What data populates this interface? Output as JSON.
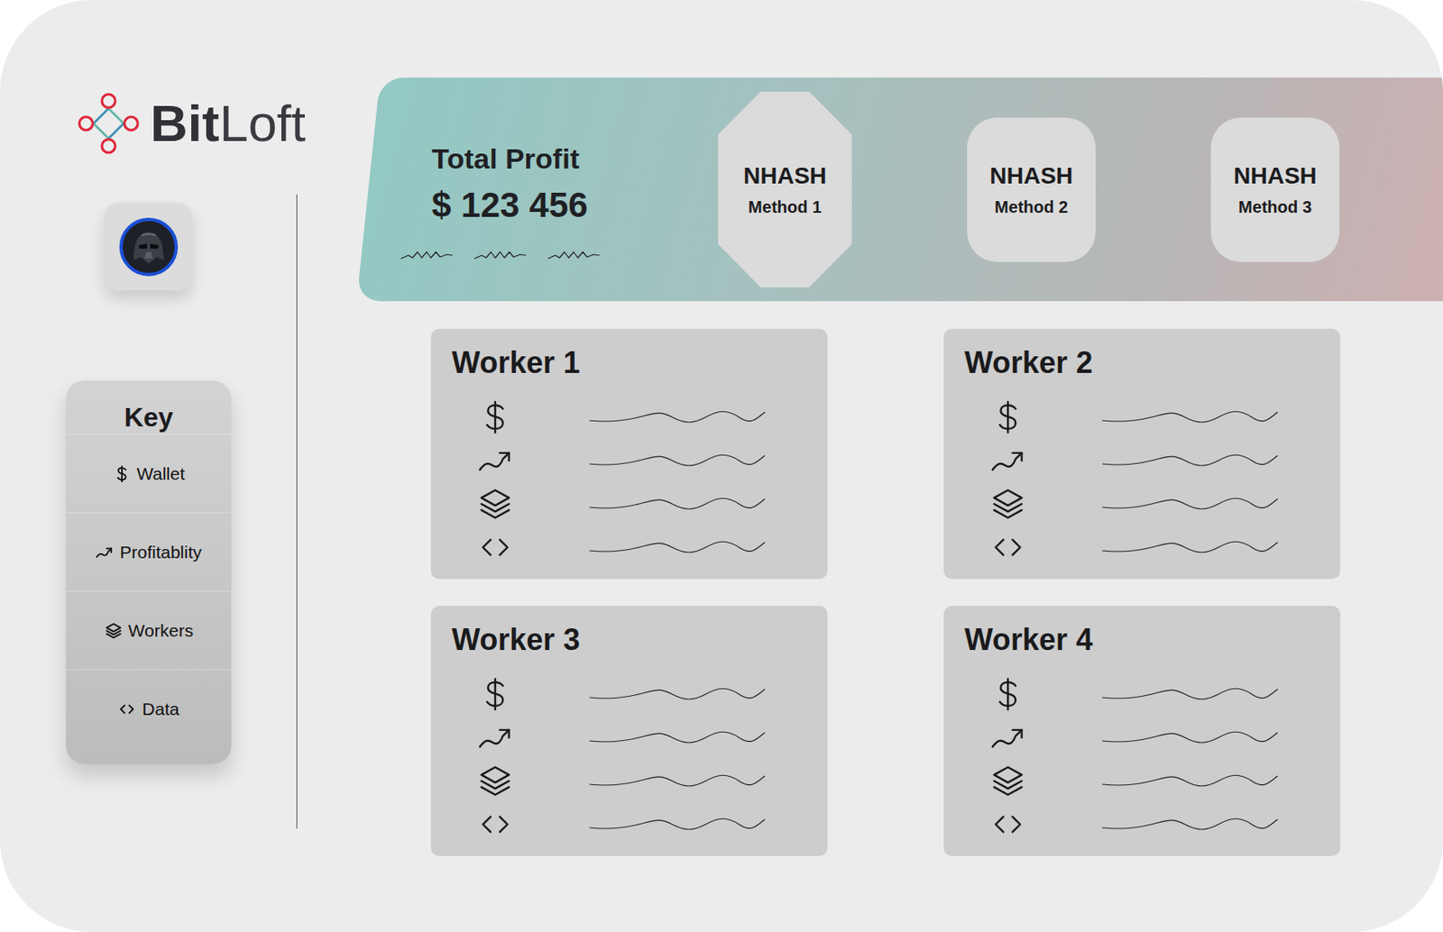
{
  "logo": {
    "bold": "Bit",
    "light": "Loft"
  },
  "key": {
    "title": "Key",
    "items": [
      {
        "kind": "wallet",
        "label": "Wallet"
      },
      {
        "kind": "profitability",
        "label": "Profitablity"
      },
      {
        "kind": "workers",
        "label": "Workers"
      },
      {
        "kind": "data",
        "label": "Data"
      }
    ]
  },
  "summary": {
    "title": "Total Profit",
    "value": "$ 123 456"
  },
  "methods": [
    {
      "name": "NHASH",
      "label": "Method 1",
      "selected": true
    },
    {
      "name": "NHASH",
      "label": "Method 2",
      "selected": false
    },
    {
      "name": "NHASH",
      "label": "Method 3",
      "selected": false
    }
  ],
  "workers": [
    {
      "title": "Worker 1",
      "rows": [
        {
          "kind": "wallet"
        },
        {
          "kind": "profitability"
        },
        {
          "kind": "workers"
        },
        {
          "kind": "data"
        }
      ]
    },
    {
      "title": "Worker 2",
      "rows": [
        {
          "kind": "wallet"
        },
        {
          "kind": "profitability"
        },
        {
          "kind": "workers"
        },
        {
          "kind": "data"
        }
      ]
    },
    {
      "title": "Worker 3",
      "rows": [
        {
          "kind": "wallet"
        },
        {
          "kind": "profitability"
        },
        {
          "kind": "workers"
        },
        {
          "kind": "data"
        }
      ]
    },
    {
      "title": "Worker 4",
      "rows": [
        {
          "kind": "wallet"
        },
        {
          "kind": "profitability"
        },
        {
          "kind": "workers"
        },
        {
          "kind": "data"
        }
      ]
    }
  ]
}
